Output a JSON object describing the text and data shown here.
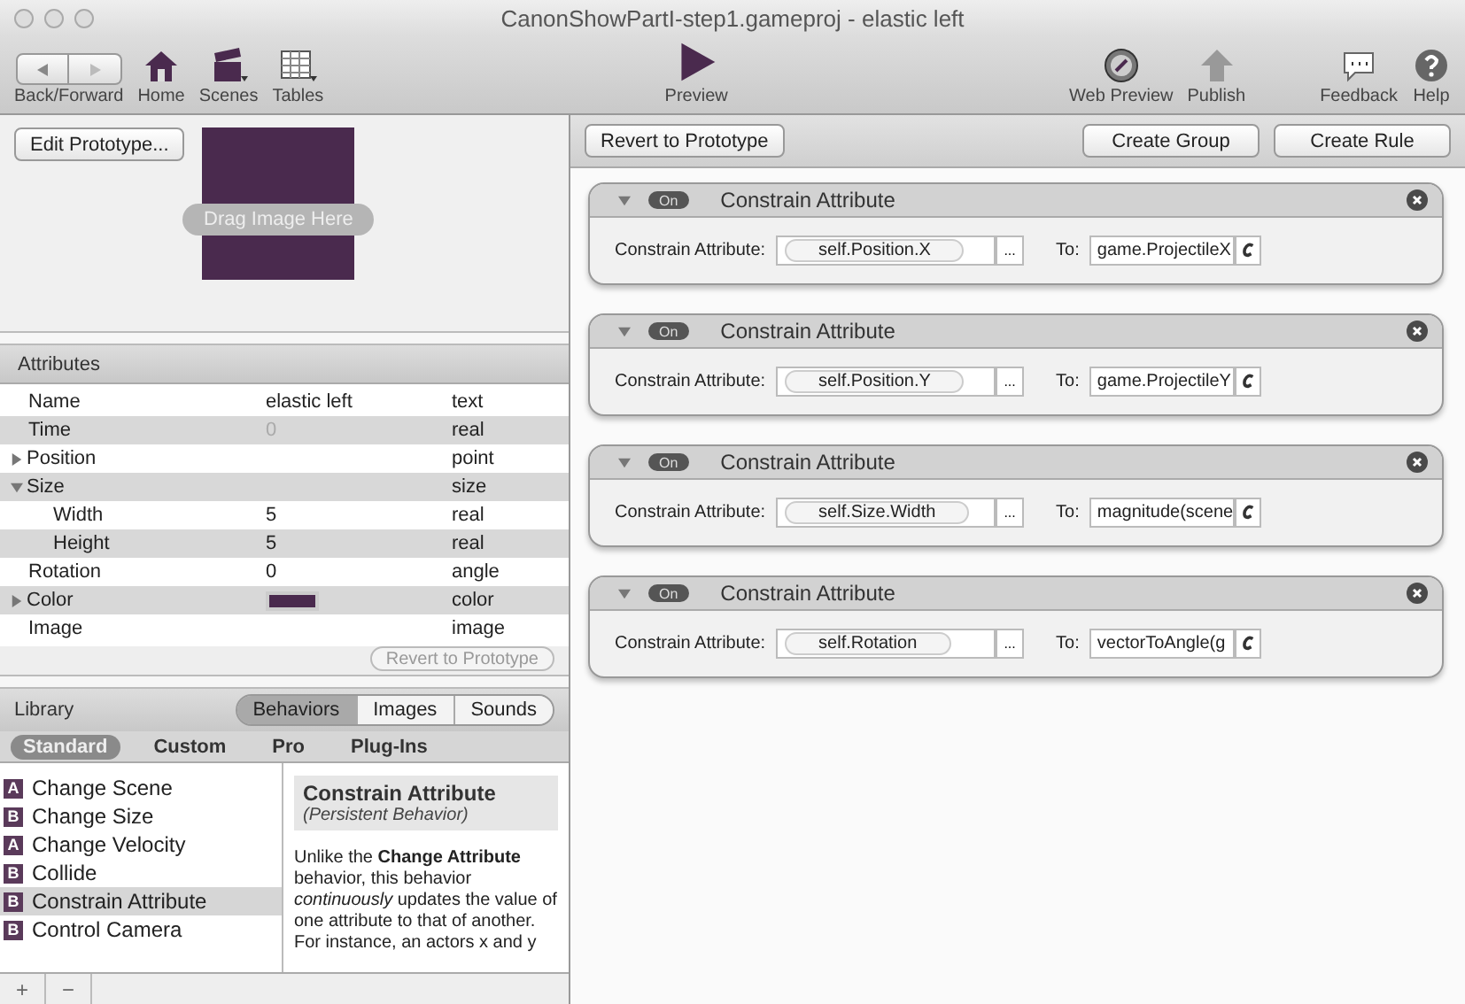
{
  "window": {
    "title": "CanonShowPartI-step1.gameproj - elastic left"
  },
  "toolbar": {
    "left": [
      {
        "kind": "nav",
        "label": "Back/Forward"
      },
      {
        "kind": "home",
        "label": "Home"
      },
      {
        "kind": "scenes",
        "label": "Scenes"
      },
      {
        "kind": "tables",
        "label": "Tables"
      }
    ],
    "center": [
      {
        "kind": "preview",
        "label": "Preview"
      }
    ],
    "right": [
      {
        "kind": "web",
        "label": "Web Preview"
      },
      {
        "kind": "publish",
        "label": "Publish"
      },
      {
        "kind": "feedback",
        "label": "Feedback"
      },
      {
        "kind": "help",
        "label": "Help"
      }
    ]
  },
  "prototype": {
    "button": "Edit Prototype...",
    "drop_hint": "Drag Image Here"
  },
  "attributes": {
    "title": "Attributes",
    "revert_button": "Revert to Prototype",
    "rows": [
      {
        "name": "Name",
        "value": "elastic left",
        "type": "text"
      },
      {
        "name": "Time",
        "value": "0",
        "type": "real",
        "disabled": true
      },
      {
        "name": "Position",
        "type": "point",
        "expanded": false
      },
      {
        "name": "Size",
        "type": "size",
        "expanded": true,
        "children": [
          {
            "name": "Width",
            "value": "5",
            "type": "real"
          },
          {
            "name": "Height",
            "value": "5",
            "type": "real"
          }
        ]
      },
      {
        "name": "Rotation",
        "value": "0",
        "type": "angle"
      },
      {
        "name": "Color",
        "type": "color",
        "expanded": false,
        "color": "#4a2a4e"
      },
      {
        "name": "Image",
        "type": "image"
      }
    ]
  },
  "library": {
    "title": "Library",
    "tabs": [
      {
        "label": "Behaviors",
        "selected": true
      },
      {
        "label": "Images",
        "selected": false
      },
      {
        "label": "Sounds",
        "selected": false
      }
    ],
    "categories": [
      {
        "label": "Standard",
        "selected": true
      },
      {
        "label": "Custom",
        "selected": false
      },
      {
        "label": "Pro",
        "selected": false
      },
      {
        "label": "Plug-Ins",
        "selected": false
      }
    ],
    "items": [
      {
        "badge": "A",
        "label": "Change Scene",
        "selected": false
      },
      {
        "badge": "B",
        "label": "Change Size",
        "selected": false
      },
      {
        "badge": "A",
        "label": "Change Velocity",
        "selected": false
      },
      {
        "badge": "B",
        "label": "Collide",
        "selected": false
      },
      {
        "badge": "B",
        "label": "Constrain Attribute",
        "selected": true
      },
      {
        "badge": "B",
        "label": "Control Camera",
        "selected": false
      }
    ],
    "description": {
      "title": "Constrain Attribute",
      "subtitle": "(Persistent Behavior)",
      "lines": [
        "Unlike the **Change Attribute**",
        "behavior, this behavior",
        "*continuously* updates the value of",
        "one attribute to that of another.",
        "For instance, an actors x and y"
      ]
    },
    "bottom_buttons": [
      "+",
      "−"
    ]
  },
  "editor": {
    "revert_button": "Revert to Prototype",
    "buttons": [
      "Create Group",
      "Create Rule"
    ],
    "behaviors": [
      {
        "toggle": "On",
        "on": true,
        "title": "Constrain Attribute",
        "label": "Constrain Attribute:",
        "attribute": "self.Position.X",
        "more": "...",
        "to_label": "To:",
        "expression": "game.ProjectileX"
      },
      {
        "toggle": "On",
        "on": true,
        "title": "Constrain Attribute",
        "label": "Constrain Attribute:",
        "attribute": "self.Position.Y",
        "more": "...",
        "to_label": "To:",
        "expression": "game.ProjectileY"
      },
      {
        "toggle": "On",
        "on": true,
        "title": "Constrain Attribute",
        "label": "Constrain Attribute:",
        "attribute": "self.Size.Width",
        "more": "...",
        "to_label": "To:",
        "expression": "magnitude(scene"
      },
      {
        "toggle": "On",
        "on": true,
        "title": "Constrain Attribute",
        "label": "Constrain Attribute:",
        "attribute": "self.Rotation",
        "more": "...",
        "to_label": "To:",
        "expression": "vectorToAngle(g"
      }
    ]
  }
}
